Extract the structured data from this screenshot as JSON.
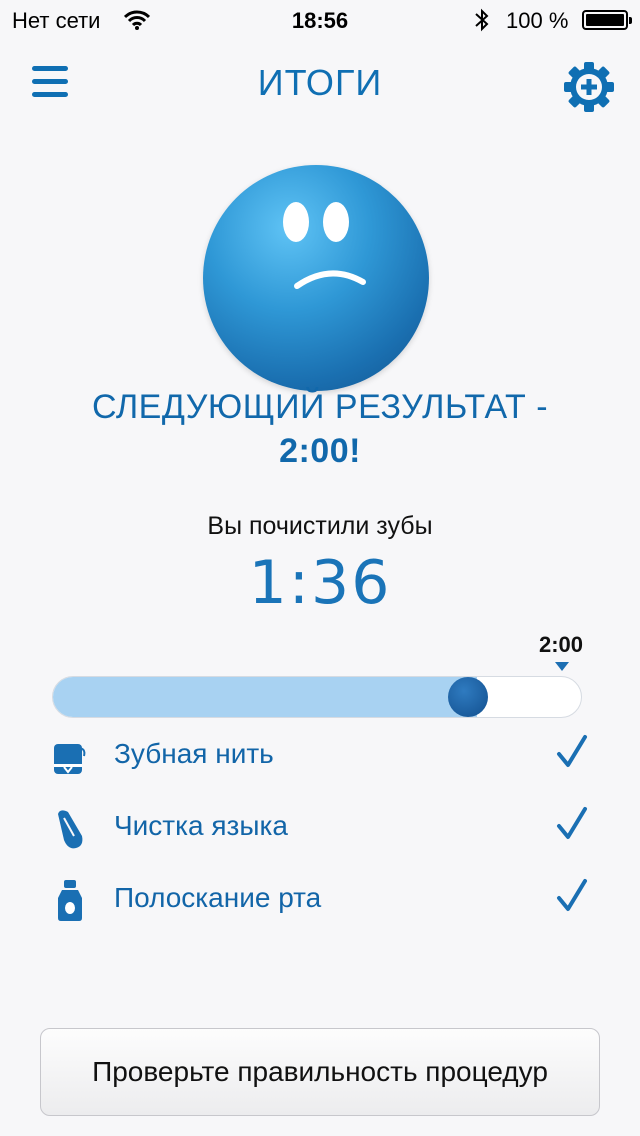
{
  "status_bar": {
    "carrier": "Нет сети",
    "time": "18:56",
    "battery": "100 %"
  },
  "nav": {
    "title": "ИТОГИ",
    "menu_icon": "hamburger-menu-icon",
    "settings_icon": "gear-plus-icon"
  },
  "result": {
    "face_icon": "sad-face-icon",
    "headline_line1": "СЛЕДУЮЩИЙ РЕЗУЛЬТАТ -",
    "headline_line2": "2:00!",
    "brushed_label": "Вы почистили зубы",
    "brushed_time": "1:36"
  },
  "progress": {
    "target_label": "2:00",
    "value_fraction": 0.8
  },
  "tasks": [
    {
      "label": "Зубная нить",
      "icon": "floss-icon",
      "checked": true
    },
    {
      "label": "Чистка языка",
      "icon": "tongue-icon",
      "checked": true
    },
    {
      "label": "Полоскание рта",
      "icon": "mouthwash-icon",
      "checked": true
    }
  ],
  "action_button": {
    "label": "Проверьте правильность процедур"
  },
  "colors": {
    "accent": "#0f6fb3",
    "progress_fill": "#a8d2f2",
    "background": "#f7f7f9"
  }
}
